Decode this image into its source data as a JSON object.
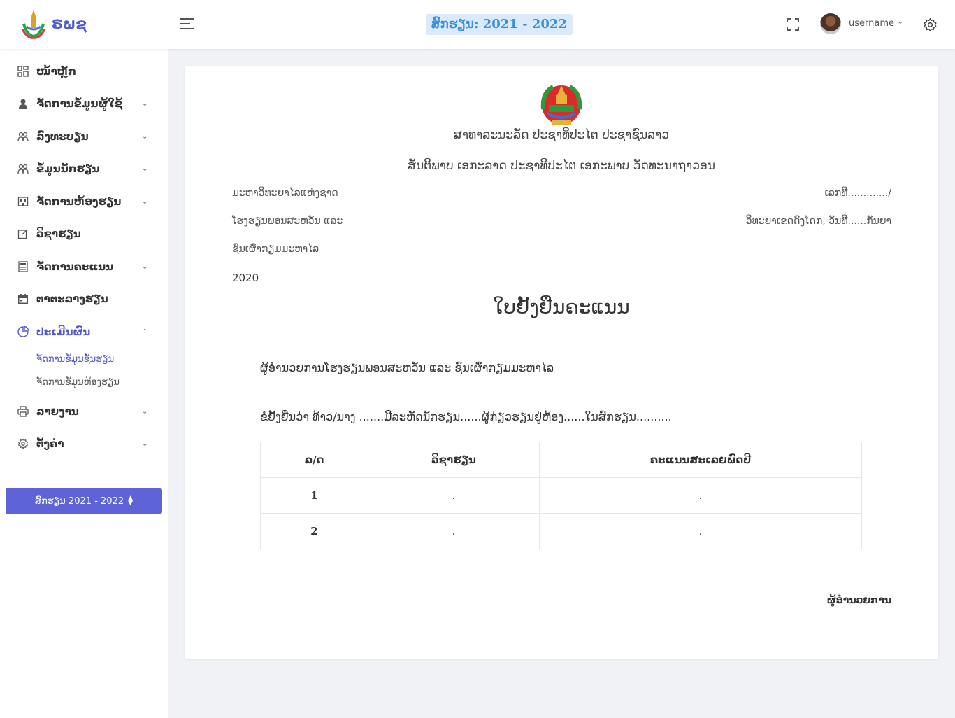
{
  "header": {
    "logo_text": "ຣພຊ",
    "academic_year_badge": "ສົກຮຽນ: 2021 - 2022",
    "username": "username"
  },
  "sidebar": {
    "items": [
      {
        "label": "ໜ້າຫຼັກ",
        "icon": "dashboard-icon"
      },
      {
        "label": "ຈັດການຂໍ້ມູນຜູ້ໃຊ້",
        "icon": "user-icon"
      },
      {
        "label": "ລົງທະບຽນ",
        "icon": "users-icon"
      },
      {
        "label": "ຂໍ້ມູນນັກຮຽນ",
        "icon": "students-icon"
      },
      {
        "label": "ຈັດການຫ້ອງຮຽນ",
        "icon": "classroom-icon"
      },
      {
        "label": "ວິຊາຮຽນ",
        "icon": "edit-icon"
      },
      {
        "label": "ຈັດການຄະແນນ",
        "icon": "calculator-icon"
      },
      {
        "label": "ຕາຕະລາງຮຽນ",
        "icon": "calendar-icon"
      },
      {
        "label": "ປະເມີນຜົນ",
        "icon": "pie-chart-icon"
      },
      {
        "label": "ລາຍງານ",
        "icon": "printer-icon"
      },
      {
        "label": "ຕັ້ງຄ່າ",
        "icon": "gear-icon"
      }
    ],
    "sub_items": [
      "ຈັດການຂໍ້ມູນຊັ້ນຮຽນ",
      "ຈັດການຂໍ້ມູນຫ້ອງຮຽນ"
    ],
    "year_select": "ສົກຮຽນ 2021 - 2022"
  },
  "document": {
    "country_line": "ສາທາລະນະລັດ ປະຊາທິປະໄຕ ປະຊາຊົນລາວ",
    "motto_line": "ສັນຕິພາບ ເອກະລາດ ປະຊາທິປະໄຕ ເອກະພາບ ວັດທະນາຖາວອນ",
    "left_lines": [
      "ມະຫາວິທະຍາໄລແຫ່ງຊາດ",
      "ໂຮງຮຽນພອນສະຫວັນ ແລະ",
      "ຊົນເຜົ່າກຽມມະຫາໄລ",
      "2020"
    ],
    "right_lines": [
      "ເລກທີ............./",
      "ວິທະຍາເຂດດົງໂດກ, ວັນທີ......ກັນຍາ"
    ],
    "title": "ໃບຢັ້ງຢືນຄະແນນ",
    "addressee": "ຜູ້ອຳນວຍການໂຮງຮຽນພອນສະຫວັນ ແລະ ຊົນເຜົ່າກຽມມະຫາໄລ",
    "statement": "ຂໍຢັ້ງຢືນວ່າ ທ້າວ/ນາງ .......ມີລະຫັດນັກຮຽນ......ຜູ້ກ່ຽວຮຽນຢູ່ຫ້ອງ......ໃນສົກຮຽນ..........",
    "table": {
      "headers": [
        "ລ/ດ",
        "ວິຊາຮຽນ",
        "ຄະແນນສະເລຍພົດປີ"
      ],
      "rows": [
        [
          "1",
          ".",
          "."
        ],
        [
          "2",
          ".",
          "."
        ]
      ]
    },
    "signature": "ຜູ້ອຳນວຍການ"
  }
}
